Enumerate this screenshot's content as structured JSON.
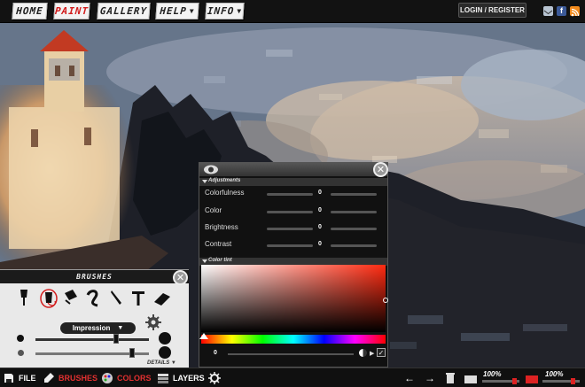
{
  "nav": {
    "items": [
      {
        "label": "HOME",
        "active": false,
        "dropdown": false
      },
      {
        "label": "PAINT",
        "active": true,
        "dropdown": false
      },
      {
        "label": "GALLERY",
        "active": false,
        "dropdown": false
      },
      {
        "label": "HELP",
        "active": false,
        "dropdown": true
      },
      {
        "label": "INFO",
        "active": false,
        "dropdown": true
      }
    ],
    "login_label": "LOGIN / REGISTER",
    "social_icons": [
      "mail-icon",
      "facebook-icon",
      "rss-icon"
    ]
  },
  "brushes_panel": {
    "title": "BRUSHES",
    "tools": [
      "paintbrush-icon",
      "blob-brush-icon",
      "smudge-icon",
      "curve-icon",
      "pen-icon",
      "text-icon",
      "eraser-icon"
    ],
    "selected_tool": "blob-brush-icon",
    "brush_type": "Impression",
    "details_label": "DETAILS"
  },
  "adjust_panel": {
    "section_adjustments": "Adjustments",
    "rows": [
      {
        "label": "Colorfulness",
        "value": "0"
      },
      {
        "label": "Color",
        "value": "0"
      },
      {
        "label": "Brightness",
        "value": "0"
      },
      {
        "label": "Contrast",
        "value": "0"
      }
    ],
    "section_tint": "Color tint",
    "tint_value": "0"
  },
  "bottom": {
    "file": "FILE",
    "brushes": "BRUSHES",
    "colors": "COLORS",
    "layers": "LAYERS",
    "zoom_1": "100%",
    "zoom_2": "100%"
  },
  "colors": {
    "accent": "#d21d1d",
    "tint_red": "#ff2a10"
  }
}
